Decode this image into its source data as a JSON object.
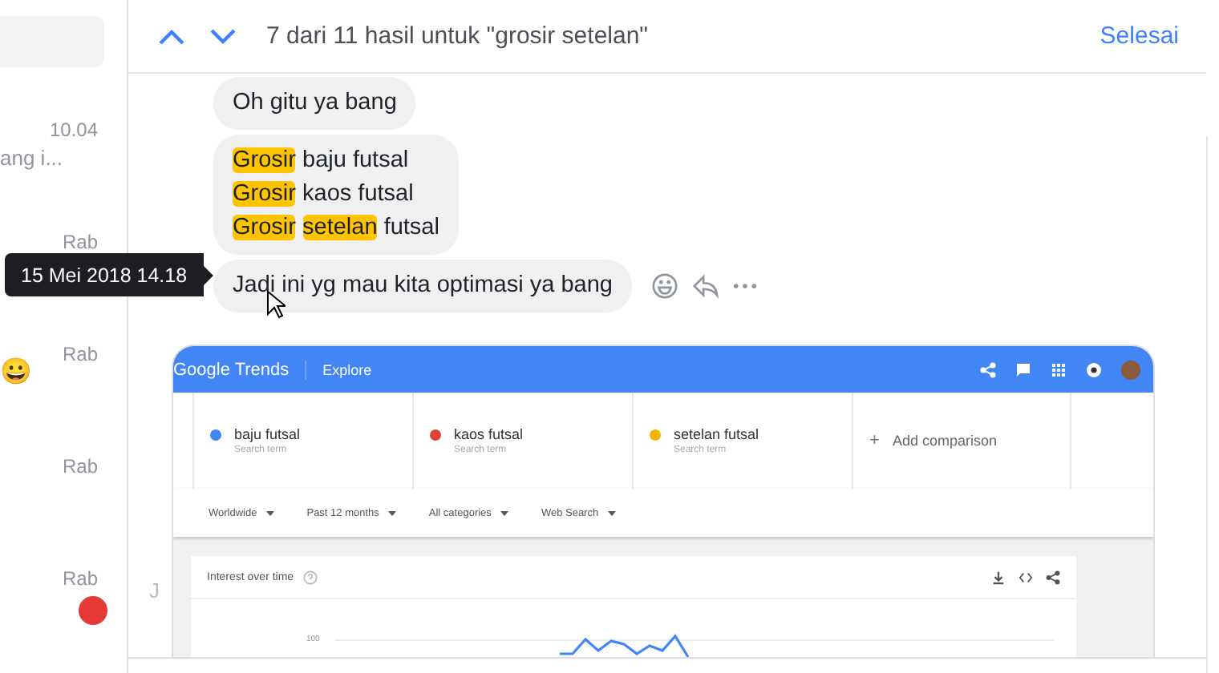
{
  "sidebar": {
    "items": [
      {
        "time": "10.04",
        "preview": "ang i...",
        "avatar": false
      },
      {
        "time": "Rab",
        "avatar": false
      },
      {
        "time": "Rab",
        "preview": "😀",
        "avatar": false
      },
      {
        "time": "Rab",
        "avatar": false
      },
      {
        "time": "Rab",
        "avatar": true
      }
    ]
  },
  "search_bar": {
    "status": "7 dari 11 hasil untuk \"grosir setelan\"",
    "done": "Selesai"
  },
  "messages": [
    {
      "actions": false,
      "lines": [
        [
          {
            "text": "Oh gitu ya bang",
            "highlighted": false
          }
        ]
      ]
    },
    {
      "actions": false,
      "lines": [
        [
          {
            "text": "Grosir",
            "highlighted": true
          },
          {
            "text": "baju futsal",
            "highlighted": false
          }
        ],
        [
          {
            "text": "Grosir",
            "highlighted": true
          },
          {
            "text": "kaos futsal",
            "highlighted": false
          }
        ],
        [
          {
            "text": "Grosir",
            "highlighted": true
          },
          {
            "text": "setelan",
            "highlighted": true
          },
          {
            "text": "futsal",
            "highlighted": false
          }
        ]
      ]
    },
    {
      "actions": true,
      "lines": [
        [
          {
            "text": "Jadi ini yg mau kita optimasi ya bang",
            "highlighted": false
          }
        ]
      ]
    }
  ],
  "tooltip": "15 Mei 2018 14.18",
  "side_letter": "J",
  "attachment": {
    "logo": "Google Trends",
    "nav": "Explore",
    "terms": [
      {
        "name": "baju futsal",
        "sub": "Search term",
        "color": "#4285f4"
      },
      {
        "name": "kaos futsal",
        "sub": "Search term",
        "color": "#db4437"
      },
      {
        "name": "setelan futsal",
        "sub": "Search term",
        "color": "#f4b400"
      }
    ],
    "add_icon": "+",
    "add": "Add comparison",
    "filters": [
      "Worldwide",
      "Past 12 months",
      "All categories",
      "Web Search"
    ],
    "card_title": "Interest over time",
    "tick": "100"
  }
}
